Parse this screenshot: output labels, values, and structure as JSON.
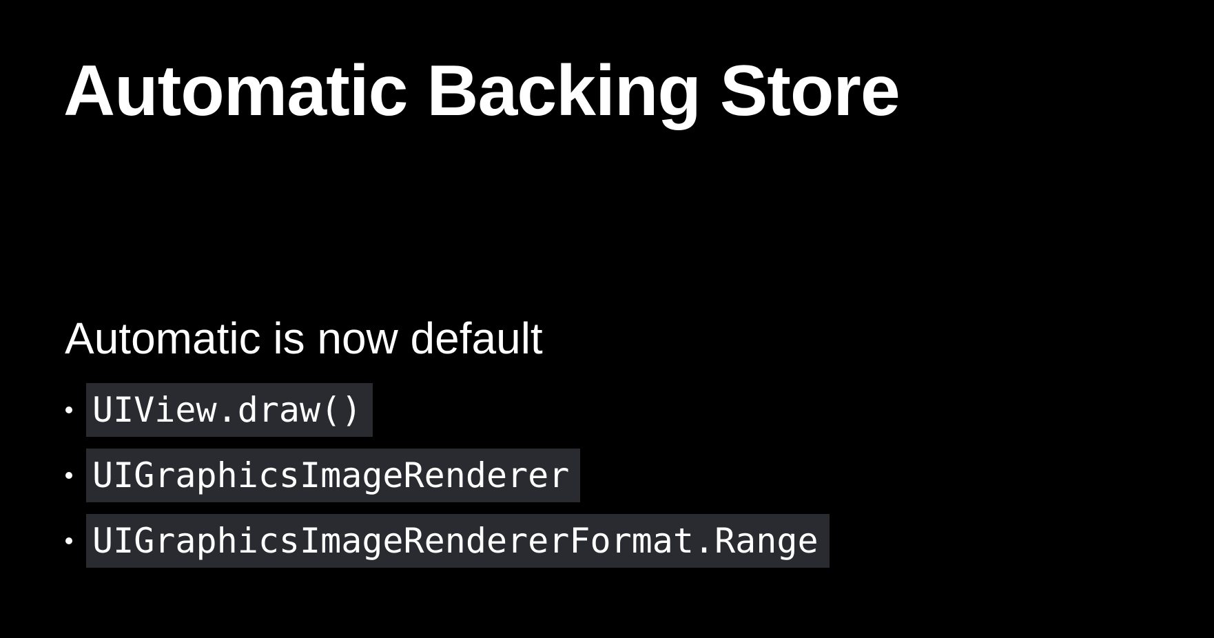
{
  "slide": {
    "title": "Automatic Backing Store",
    "subtitle": "Automatic is now default",
    "bullets": [
      {
        "code": "UIView.draw()"
      },
      {
        "code": "UIGraphicsImageRenderer"
      },
      {
        "code": "UIGraphicsImageRendererFormat.Range"
      }
    ],
    "colors": {
      "background": "#000000",
      "text": "#ffffff",
      "code_background": "#2a2b31"
    }
  }
}
